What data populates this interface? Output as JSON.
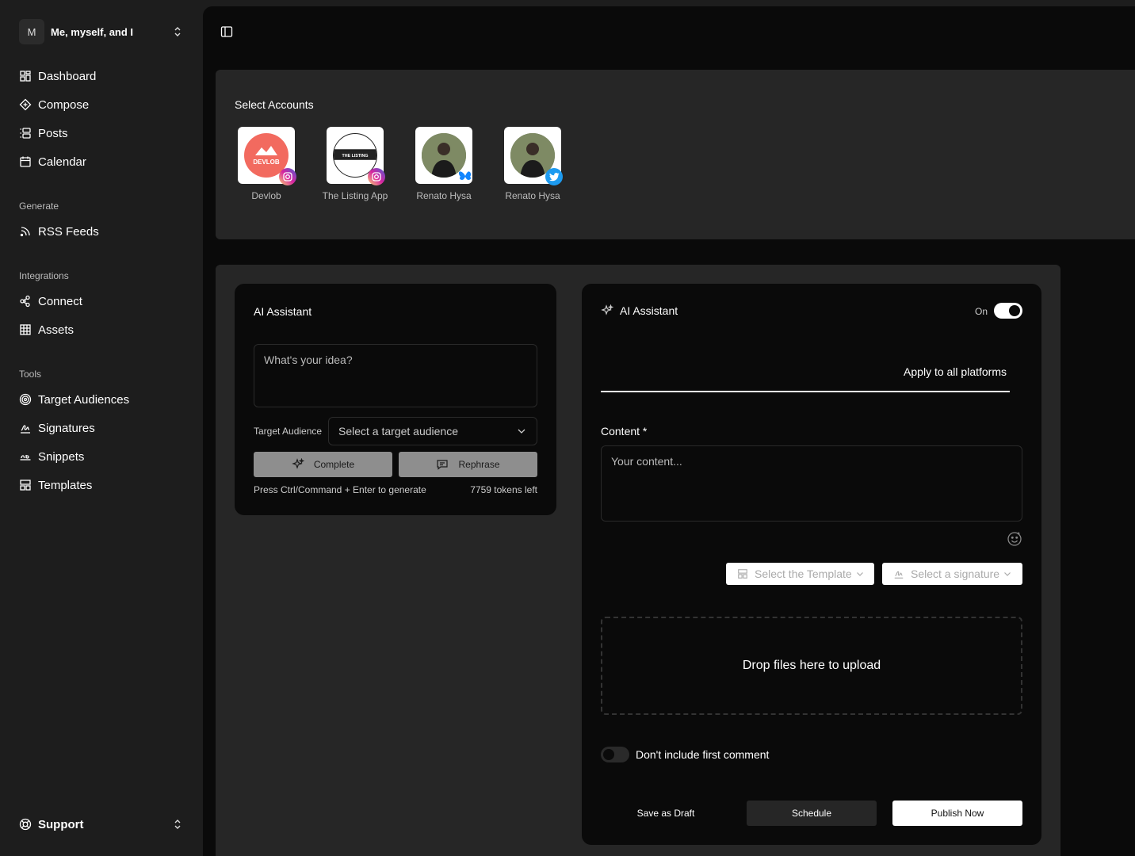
{
  "workspace": {
    "initial": "M",
    "name": "Me, myself, and I"
  },
  "nav": {
    "main": [
      {
        "label": "Dashboard",
        "icon": "dashboard-icon"
      },
      {
        "label": "Compose",
        "icon": "compose-icon"
      },
      {
        "label": "Posts",
        "icon": "posts-icon"
      },
      {
        "label": "Calendar",
        "icon": "calendar-icon"
      }
    ],
    "generate_label": "Generate",
    "generate": [
      {
        "label": "RSS Feeds",
        "icon": "rss-icon"
      }
    ],
    "integrations_label": "Integrations",
    "integrations": [
      {
        "label": "Connect",
        "icon": "connect-icon"
      },
      {
        "label": "Assets",
        "icon": "grid-icon"
      }
    ],
    "tools_label": "Tools",
    "tools": [
      {
        "label": "Target Audiences",
        "icon": "target-icon"
      },
      {
        "label": "Signatures",
        "icon": "signature-icon"
      },
      {
        "label": "Snippets",
        "icon": "snippet-icon"
      },
      {
        "label": "Templates",
        "icon": "template-icon"
      }
    ],
    "support": "Support"
  },
  "accounts": {
    "title": "Select Accounts",
    "items": [
      {
        "name": "Devlob",
        "platform": "instagram"
      },
      {
        "name": "The Listing App",
        "platform": "instagram"
      },
      {
        "name": "Renato Hysa",
        "platform": "bluesky"
      },
      {
        "name": "Renato Hysa",
        "platform": "twitter"
      }
    ]
  },
  "ai_left": {
    "title": "AI Assistant",
    "idea_placeholder": "What's your idea?",
    "target_label": "Target Audience",
    "target_placeholder": "Select a target audience",
    "complete": "Complete",
    "rephrase": "Rephrase",
    "hint": "Press Ctrl/Command + Enter to generate",
    "tokens": "7759 tokens left"
  },
  "ai_right": {
    "title": "AI Assistant",
    "on_label": "On",
    "apply_all": "Apply to all platforms",
    "content_label": "Content *",
    "content_placeholder": "Your content...",
    "template_select": "Select the Template",
    "signature_select": "Select a signature",
    "drop": "Drop files here to upload",
    "first_comment": "Don't include first comment",
    "save_draft": "Save as Draft",
    "schedule": "Schedule",
    "publish": "Publish Now"
  },
  "colors": {
    "accent": "#ffffff",
    "devlob": "#f26a5f",
    "instagram": "#d6249f",
    "bluesky": "#1185fe",
    "twitter": "#1d9bf0"
  }
}
